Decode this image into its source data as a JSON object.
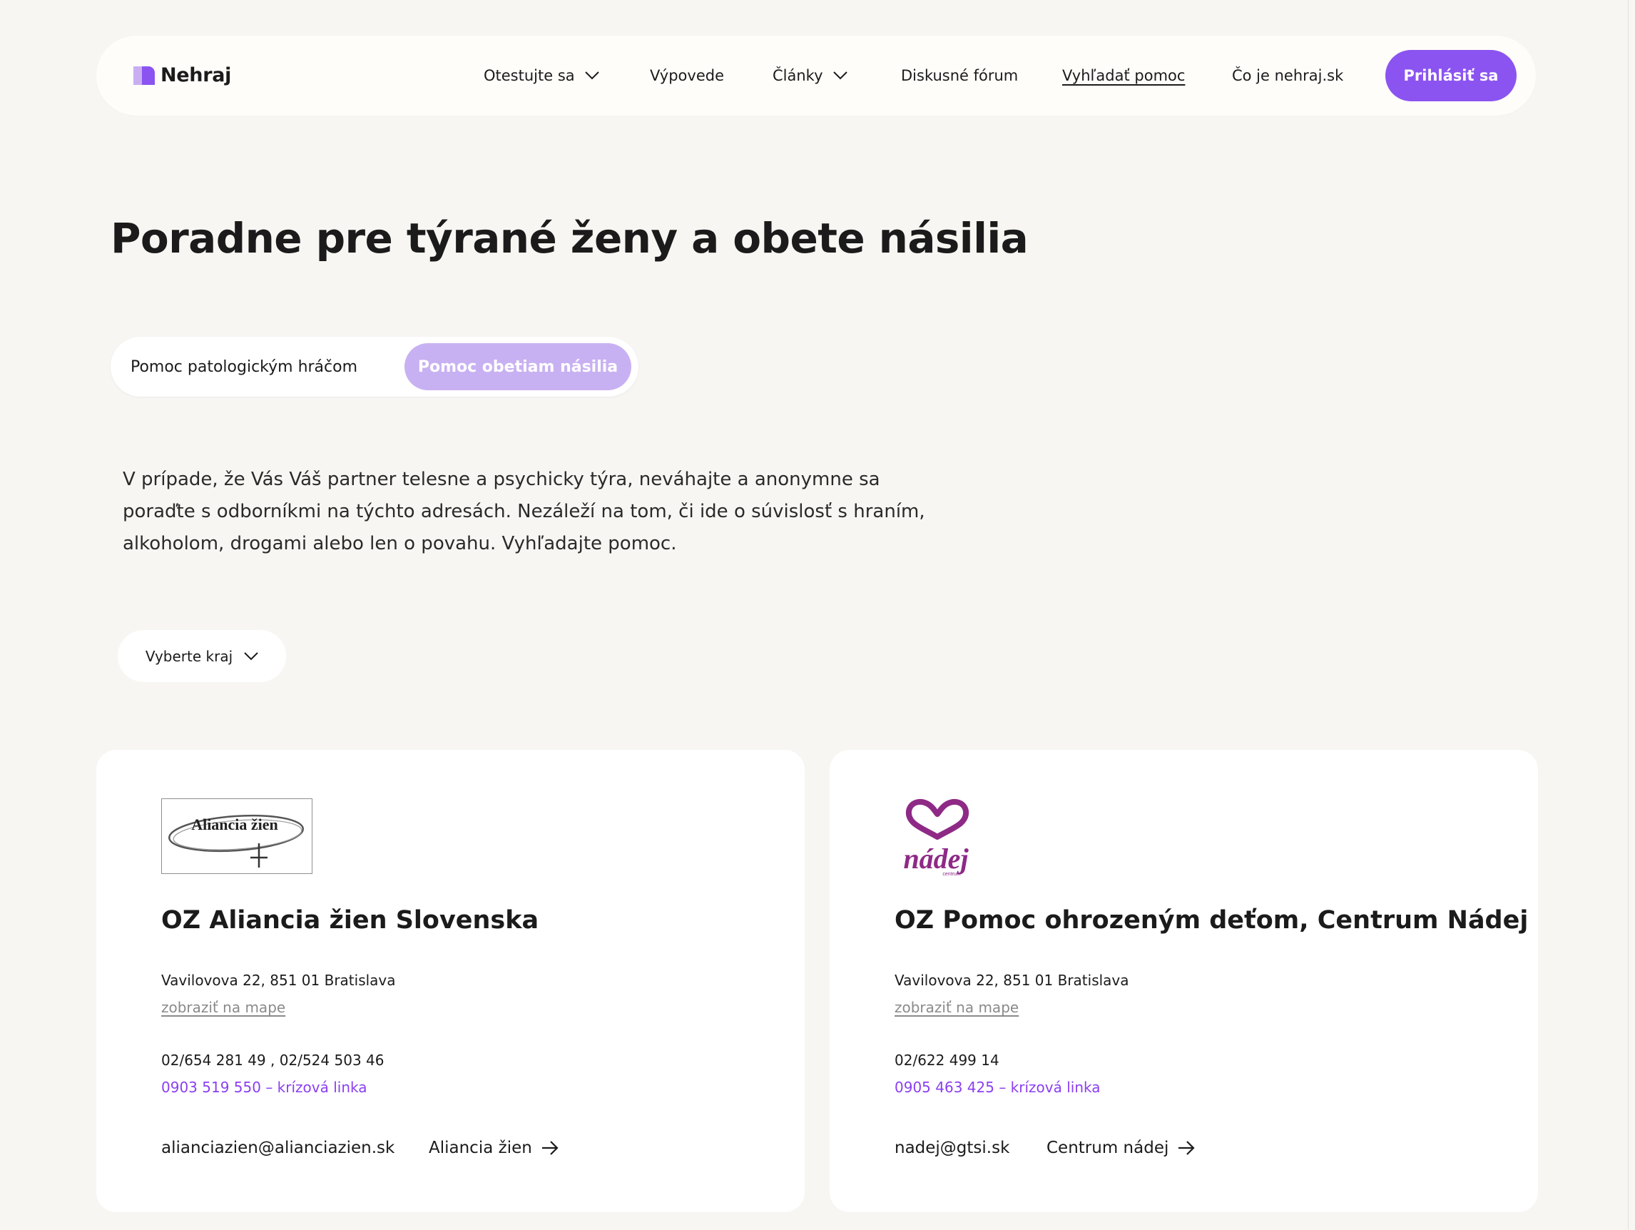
{
  "brand": {
    "name": "Nehraj"
  },
  "nav": {
    "items": [
      {
        "label": "Otestujte sa",
        "has_dropdown": true
      },
      {
        "label": "Výpovede",
        "has_dropdown": false
      },
      {
        "label": "Články",
        "has_dropdown": true
      },
      {
        "label": "Diskusné fórum",
        "has_dropdown": false
      },
      {
        "label": "Vyhľadať pomoc",
        "has_dropdown": false,
        "active": true
      },
      {
        "label": "Čo je nehraj.sk",
        "has_dropdown": false
      }
    ],
    "login_label": "Prihlásiť sa"
  },
  "page": {
    "title": "Poradne pre týrané ženy a obete násilia",
    "tabs": [
      {
        "label": "Pomoc patologickým hráčom",
        "selected": false
      },
      {
        "label": "Pomoc obetiam násilia",
        "selected": true
      }
    ],
    "intro_lines": [
      "V prípade, že Vás Váš partner telesne a  psychicky týra, neváhajte a anonymne sa",
      "poraďte s odborníkmi na týchto adresách. Nezáleží na tom, či ide o súvislosť s hraním,",
      "alkoholom, drogami alebo len o povahu. Vyhľadajte pomoc."
    ],
    "region_label": "Vyberte kraj"
  },
  "cards": [
    {
      "logo_text": "Aliancia žien",
      "title": "OZ Aliancia žien Slovenska",
      "address": "Vavilovova 22, 851 01 Bratislava",
      "map_label": "zobraziť na mape",
      "phone": "02/654 281 49 , 02/524 503 46",
      "crisis": "0903 519 550 – krízová linka",
      "email": "alianciazien@alianciazien.sk",
      "link_label": "Aliancia žien"
    },
    {
      "logo_text": "nádej",
      "logo_subtext": "centrum",
      "title": "OZ Pomoc ohrozeným deťom, Centrum Nádej",
      "address": "Vavilovova 22, 851 01 Bratislava",
      "map_label": "zobraziť na mape",
      "phone": "02/622 499 14",
      "crisis": "0905 463 425 – krízová linka",
      "email": "nadej@gtsi.sk",
      "link_label": "Centrum nádej"
    }
  ],
  "colors": {
    "accent": "#8b54f0",
    "accent_light": "#c8b1f2",
    "crisis_text": "#8b3ff0",
    "nadej_brand": "#8e2a86",
    "background": "#f7f6f3"
  },
  "icons": {
    "dropdown": "chevron-down-icon",
    "link": "arrow-right-icon"
  }
}
